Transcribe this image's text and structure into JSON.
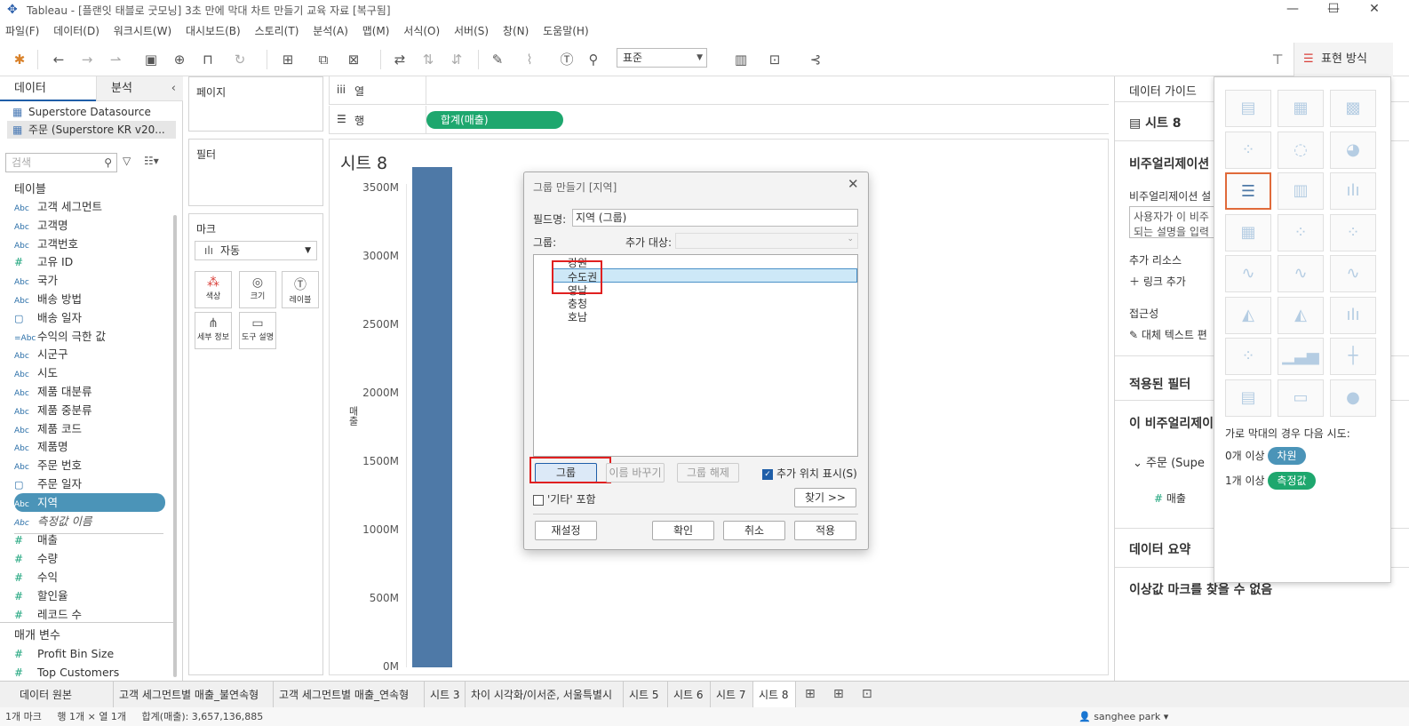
{
  "window": {
    "title": "Tableau - [플랜잇 태블로 굿모닝] 3초 만에 막대 차트 만들기 교육 자료 [복구됨]"
  },
  "menu": [
    "파일(F)",
    "데이터(D)",
    "워크시트(W)",
    "대시보드(B)",
    "스토리(T)",
    "분석(A)",
    "맵(M)",
    "서식(O)",
    "서버(S)",
    "창(N)",
    "도움말(H)"
  ],
  "toolbar": {
    "fit_select": "표준",
    "show_me_label": "표현 방식"
  },
  "left": {
    "tab_data": "데이터",
    "tab_analysis": "분석",
    "datasources": [
      "Superstore Datasource",
      "주문 (Superstore KR v20..."
    ],
    "search_placeholder": "검색",
    "tables_header": "테이블",
    "fields": [
      {
        "type": "Abc",
        "name": "고객 세그먼트"
      },
      {
        "type": "Abc",
        "name": "고객명"
      },
      {
        "type": "Abc",
        "name": "고객번호"
      },
      {
        "type": "#",
        "name": "고유 ID"
      },
      {
        "type": "Abc",
        "name": "국가"
      },
      {
        "type": "Abc",
        "name": "배송 방법"
      },
      {
        "type": "date",
        "name": "배송 일자"
      },
      {
        "type": "=Abc",
        "name": "수익의 극한 값"
      },
      {
        "type": "Abc",
        "name": "시군구"
      },
      {
        "type": "Abc",
        "name": "시도"
      },
      {
        "type": "Abc",
        "name": "제품 대분류"
      },
      {
        "type": "Abc",
        "name": "제품 중분류"
      },
      {
        "type": "Abc",
        "name": "제품 코드"
      },
      {
        "type": "Abc",
        "name": "제품명"
      },
      {
        "type": "Abc",
        "name": "주문 번호"
      },
      {
        "type": "date",
        "name": "주문 일자"
      },
      {
        "type": "Abc",
        "name": "지역"
      },
      {
        "type": "Abc",
        "name": "측정값 이름"
      },
      {
        "type": "#",
        "name": "매출"
      },
      {
        "type": "#",
        "name": "수량"
      },
      {
        "type": "#",
        "name": "수익"
      },
      {
        "type": "#",
        "name": "할인율"
      },
      {
        "type": "#",
        "name": "레코드 수"
      }
    ],
    "params_header": "매개 변수",
    "params": [
      "Profit Bin Size",
      "Top Customers"
    ]
  },
  "cards": {
    "pages": "페이지",
    "filters": "필터",
    "marks": "마크",
    "marks_type": "자동",
    "mark_buttons": [
      "색상",
      "크기",
      "레이블",
      "세부 정보",
      "도구 설명"
    ]
  },
  "shelves": {
    "columns": "열",
    "rows": "행",
    "rows_pill": "합계(매출)"
  },
  "view": {
    "title": "시트 8",
    "yaxis_label": "매출"
  },
  "chart_data": {
    "type": "bar",
    "categories": [
      ""
    ],
    "values": [
      3657136885
    ],
    "ylabel": "매출",
    "yticks": [
      "3500M",
      "3000M",
      "2500M",
      "2000M",
      "1500M",
      "1000M",
      "500M",
      "0M"
    ],
    "ylim": [
      0,
      3700000000
    ],
    "color": "#4e79a7"
  },
  "dialog": {
    "title": "그룹 만들기 [지역]",
    "field_name_label": "필드명:",
    "field_name_value": "지역 (그룹)",
    "group_label": "그룹:",
    "add_to_label": "추가 대상:",
    "items": [
      "강원",
      "수도권",
      "영남",
      "충청",
      "호남"
    ],
    "btn_group": "그룹",
    "btn_rename": "이름 바꾸기",
    "btn_ungroup": "그룹 해제",
    "show_seen": "추가 위치 표시(S)",
    "include_other": "'기타' 포함",
    "btn_find": "찾기 >>",
    "btn_reset": "재설정",
    "btn_ok": "확인",
    "btn_cancel": "취소",
    "btn_apply": "적용"
  },
  "right": {
    "guide": "데이터 가이드",
    "sheet": "시트 8",
    "viz": "비주얼리제이션",
    "viz_desc": "비주얼리제이션 설",
    "desc_text1": "사용자가 이 비주",
    "desc_text2": "되는 설명을 입력",
    "add_resource": "추가 리소스",
    "add_link": "링크 추가",
    "access": "접근성",
    "alt_text": "대체 텍스트 편",
    "filters_applied": "적용된 필터",
    "this_viz": "이 비주얼리제이",
    "order_src": "주문 (Supe",
    "sales": "매출",
    "data_summary": "데이터 요약",
    "outliers": "이상값 마크를 찾을 수 없음"
  },
  "showme": {
    "hint": "가로 막대의 경우 다음 시도:",
    "req1": "0개 이상",
    "req1_pill": "차원",
    "req2": "1개 이상",
    "req2_pill": "측정값"
  },
  "sheets": [
    "데이터 원본",
    "고객 세그먼트별 매출_불연속형",
    "고객 세그먼트별 매출_연속형",
    "시트 3",
    "차이 시각화/이서준, 서울특별시",
    "시트 5",
    "시트 6",
    "시트 7",
    "시트 8"
  ],
  "status": {
    "marks": "1개 마크",
    "rows": "행 1개",
    "cols": "열 1개",
    "sum": "합계(매출): 3,657,136,885",
    "user": "sanghee park"
  }
}
